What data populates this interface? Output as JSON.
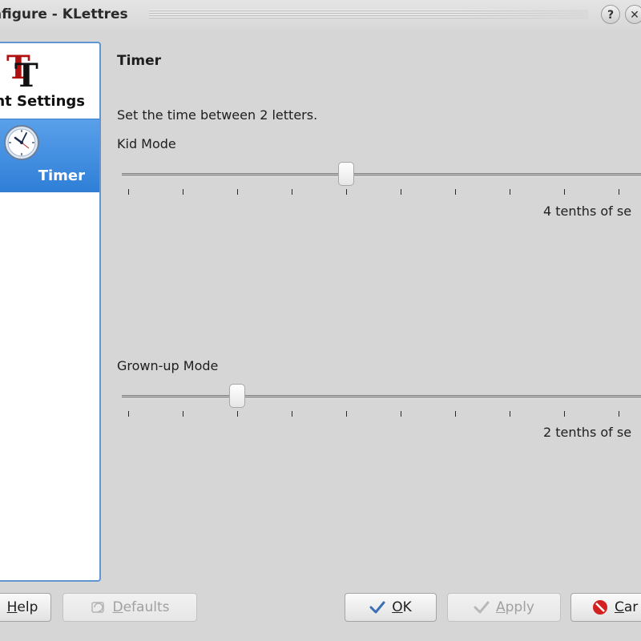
{
  "window": {
    "title": "nfigure - KLettres",
    "help_glyph": "?",
    "close_glyph": "✕"
  },
  "sidebar": {
    "items": [
      {
        "label": "Font Settings",
        "icon": "font-tt-icon",
        "selected": false
      },
      {
        "label": "Timer",
        "icon": "clock-icon",
        "selected": true
      }
    ]
  },
  "page": {
    "title": "Timer",
    "description": "Set the time between 2 letters.",
    "kid": {
      "label": "Kid Mode",
      "value_text": "4 tenths of se",
      "value": 4,
      "range": [
        0,
        9
      ]
    },
    "grownup": {
      "label": "Grown-up Mode",
      "value_text": "2 tenths of se",
      "value": 2,
      "range": [
        0,
        9
      ]
    }
  },
  "buttons": {
    "help": {
      "mnemonic": "H",
      "rest": "elp",
      "icon": "help-icon"
    },
    "defaults": {
      "mnemonic": "D",
      "rest": "efaults",
      "icon": "defaults-icon"
    },
    "ok": {
      "mnemonic": "O",
      "rest": "K",
      "icon": "check-icon"
    },
    "apply": {
      "mnemonic": "A",
      "rest": "pply",
      "icon": "check-icon"
    },
    "cancel": {
      "mnemonic": "C",
      "rest": "ar",
      "icon": "cancel-icon"
    }
  },
  "colors": {
    "selection": "#3d8be0",
    "cancel_red": "#d32020",
    "check_blue": "#3a6fb5"
  }
}
